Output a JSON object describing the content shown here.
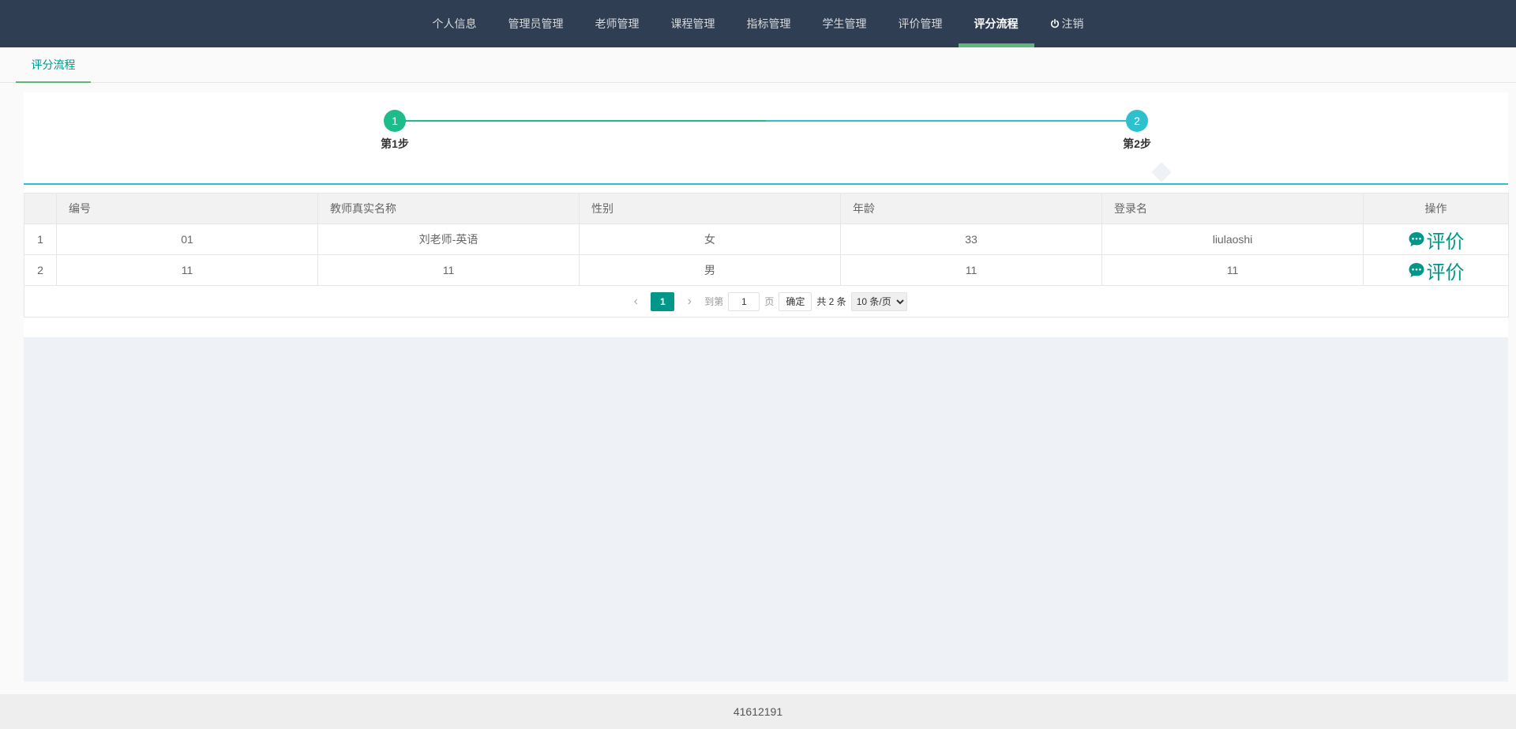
{
  "nav": {
    "items": [
      {
        "label": "个人信息"
      },
      {
        "label": "管理员管理"
      },
      {
        "label": "老师管理"
      },
      {
        "label": "课程管理"
      },
      {
        "label": "指标管理"
      },
      {
        "label": "学生管理"
      },
      {
        "label": "评价管理"
      },
      {
        "label": "评分流程"
      },
      {
        "label": "注销"
      }
    ],
    "active_index": 7
  },
  "tab": {
    "label": "评分流程"
  },
  "steps": [
    {
      "number": "1",
      "label": "第1步"
    },
    {
      "number": "2",
      "label": "第2步"
    }
  ],
  "table": {
    "headers": [
      "编号",
      "教师真实名称",
      "性别",
      "年龄",
      "登录名",
      "操作"
    ],
    "rows": [
      {
        "index": "1",
        "id": "01",
        "name": "刘老师-英语",
        "gender": "女",
        "age": "33",
        "login": "liulaoshi",
        "action": "评价"
      },
      {
        "index": "2",
        "id": "11",
        "name": "11",
        "gender": "男",
        "age": "11",
        "login": "11",
        "action": "评价"
      }
    ]
  },
  "pager": {
    "current": "1",
    "goto_label": "到第",
    "goto_value": "1",
    "page_unit": "页",
    "confirm": "确定",
    "total": "共 2 条",
    "page_size": "10 条/页"
  },
  "footer": {
    "text": "41612191"
  },
  "colors": {
    "nav_bg": "#2f3e52",
    "accent": "#009688",
    "step1": "#1dbc8a",
    "step2": "#2ec0cd"
  }
}
